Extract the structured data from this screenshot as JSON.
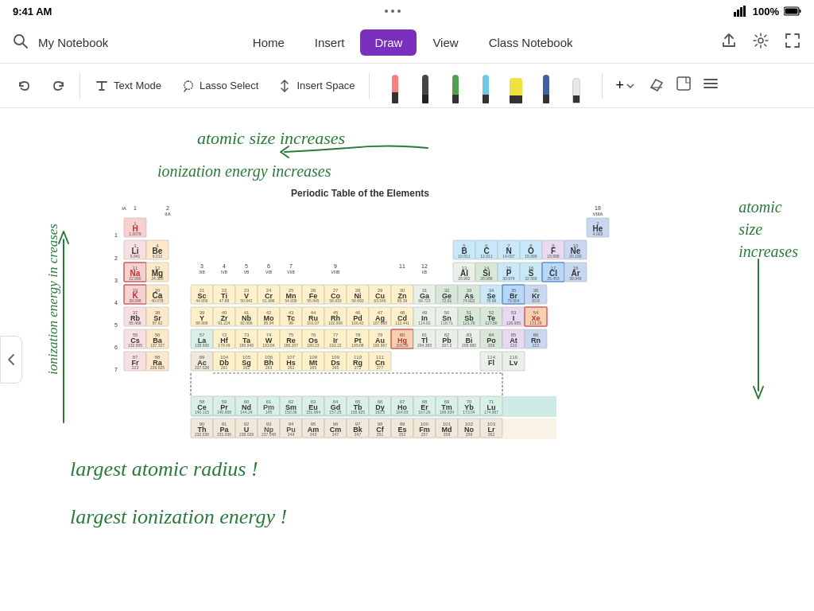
{
  "statusBar": {
    "time": "9:41 AM",
    "battery": "100%",
    "signal": "●●●●"
  },
  "nav": {
    "search_label": "My Notebook",
    "tabs": [
      "Home",
      "Insert",
      "Draw",
      "View",
      "Class Notebook"
    ],
    "activeTab": "Draw"
  },
  "toolbar": {
    "undo_label": "↩",
    "redo_label": "↪",
    "textMode_label": "Text Mode",
    "lassoSelect_label": "Lasso Select",
    "insertSpace_label": "Insert Space"
  },
  "annotations": {
    "top": "atomic size increases",
    "second": "ionization energy increases",
    "left_line1": "ionization",
    "left_line2": "energy",
    "left_line3": "in creases",
    "right_line1": "atomic",
    "right_line2": "size",
    "right_line3": "increases",
    "bottom1": "largest atomic radius !",
    "bottom2": "largest ionization energy !"
  },
  "periodicTable": {
    "title": "Periodic Table of the Elements"
  }
}
